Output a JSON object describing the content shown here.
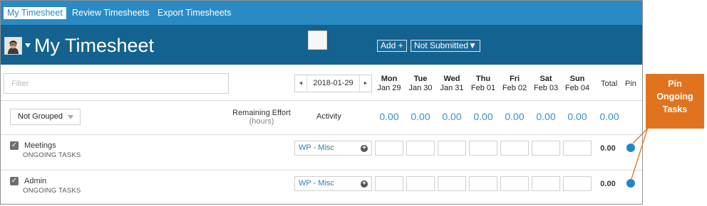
{
  "nav": {
    "items": [
      {
        "label": "My Timesheet",
        "active": true
      },
      {
        "label": "Review Timesheets",
        "active": false
      },
      {
        "label": "Export Timesheets",
        "active": false
      }
    ]
  },
  "header": {
    "title": "My Timesheet",
    "add_label": "Add +",
    "status_label": "Not Submitted▼"
  },
  "toolbar": {
    "filter_placeholder": "Filter",
    "date_value": "2018-01-29",
    "prev_arrow": "◄",
    "next_arrow": "►",
    "days": [
      {
        "name": "Mon",
        "date": "Jan 29"
      },
      {
        "name": "Tue",
        "date": "Jan 30"
      },
      {
        "name": "Wed",
        "date": "Jan 31"
      },
      {
        "name": "Thu",
        "date": "Feb 01"
      },
      {
        "name": "Fri",
        "date": "Feb 02"
      },
      {
        "name": "Sat",
        "date": "Feb 03"
      },
      {
        "name": "Sun",
        "date": "Feb 04"
      }
    ],
    "total_label": "Total",
    "pin_label": "Pin"
  },
  "grouping": {
    "selected": "Not Grouped",
    "remaining_label": "Remaining Effort",
    "remaining_unit": "(hours)",
    "activity_label": "Activity",
    "day_totals": [
      "0.00",
      "0.00",
      "0.00",
      "0.00",
      "0.00",
      "0.00",
      "0.00"
    ],
    "grand_total": "0.00"
  },
  "rows": [
    {
      "checked": true,
      "name": "Meetings",
      "group": "ONGOING TASKS",
      "activity": "WP - Misc",
      "total": "0.00",
      "pinned": true
    },
    {
      "checked": true,
      "name": "Admin",
      "group": "ONGOING TASKS",
      "activity": "WP - Misc",
      "total": "0.00",
      "pinned": true
    }
  ],
  "callout": {
    "line1": "Pin",
    "line2": "Ongoing",
    "line3": "Tasks"
  },
  "colors": {
    "nav_bg": "#2a8ac4",
    "header_bg": "#14628f",
    "accent": "#2186c8",
    "callout_bg": "#e2731e"
  }
}
